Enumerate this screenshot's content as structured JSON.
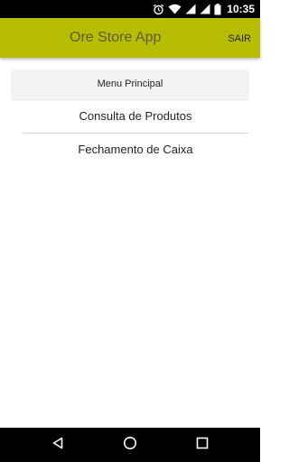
{
  "status_bar": {
    "time": "10:35",
    "icons": [
      "alarm-icon",
      "wifi-icon",
      "signal-no-data-icon",
      "cell-signal-icon",
      "battery-icon"
    ]
  },
  "app_bar": {
    "title": "Ore Store App",
    "logout_label": "SAIR",
    "color": "#b7bd00"
  },
  "menu": {
    "header": "Menu Principal",
    "items": [
      {
        "label": "Consulta de Produtos"
      },
      {
        "label": "Fechamento de Caixa"
      }
    ]
  },
  "nav_bar": {
    "icons": [
      "back-icon",
      "home-icon",
      "recents-icon"
    ]
  }
}
